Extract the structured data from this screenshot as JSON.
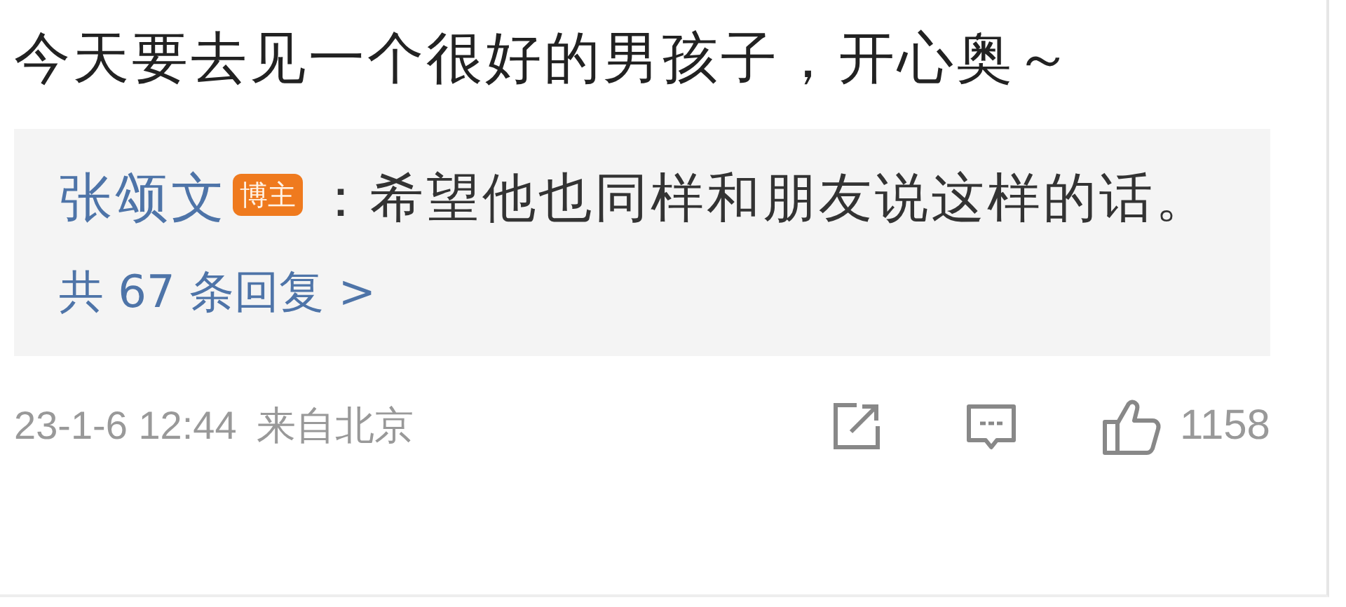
{
  "comment": {
    "text": "今天要去见一个很好的男孩子，开心奥～"
  },
  "reply": {
    "author": "张颂文",
    "badge": "博主",
    "separator": "：",
    "text": "希望他也同样和朋友说这样的话。",
    "more": "共 67 条回复 >"
  },
  "footer": {
    "time": "23-1-6 12:44",
    "location": "来自北京",
    "likes": "1158"
  }
}
